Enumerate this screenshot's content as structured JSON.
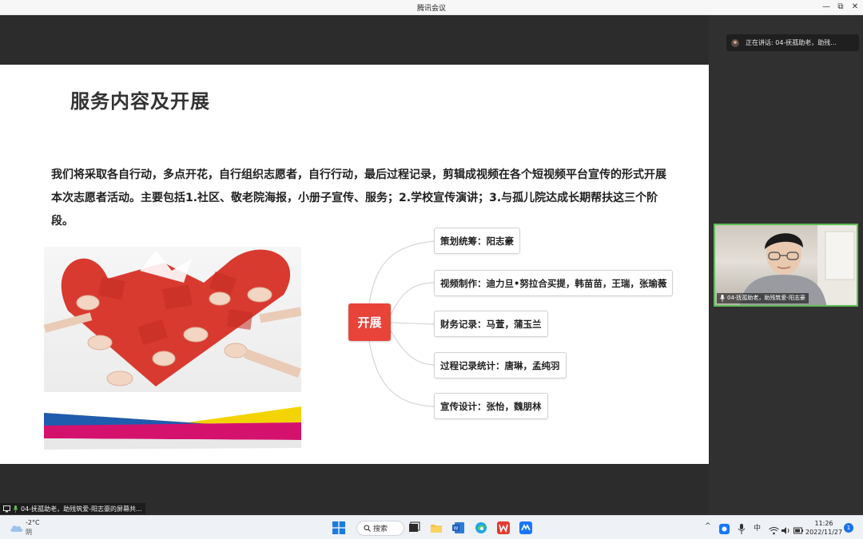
{
  "window": {
    "title": "腾讯会议"
  },
  "slide": {
    "title": "服务内容及开展",
    "body": "我们将采取各自行动，多点开花，自行组织志愿者，自行行动，最后过程记录，剪辑成视频在各个短视频平台宣传的形式开展本次志愿者活动。主要包括1.社区、敬老院海报，小册子宣传、服务；2.学校宣传演讲；3.与孤儿院达成长期帮扶这三个阶段。"
  },
  "mindmap": {
    "center": "开展",
    "nodes": [
      "策划统筹：阳志豪",
      "视频制作：迪力旦•努拉合买提，韩苗苗，王瑞，张瑜薇",
      "财务记录：马萱，蒲玉兰",
      "过程记录统计：唐琳，孟纯羽",
      "宣传设计：张怡，魏朋林"
    ]
  },
  "sidebar": {
    "speaking": "正在讲话: 04-抚孤助老，助残...",
    "camera_label": "04-抚孤助老，助残筑爱-阳志豪"
  },
  "share_bar": {
    "text": "04-抚孤助老，助残筑爱-阳志豪的屏幕共..."
  },
  "taskbar": {
    "weather_temp": "-2°C",
    "weather_desc": "阴",
    "search_label": "搜索",
    "ime": "中",
    "time": "11:26",
    "date": "2022/11/27",
    "notification_count": "1"
  },
  "colors": {
    "accent_red": "#e8443a",
    "mic_green": "#5fbf55"
  }
}
